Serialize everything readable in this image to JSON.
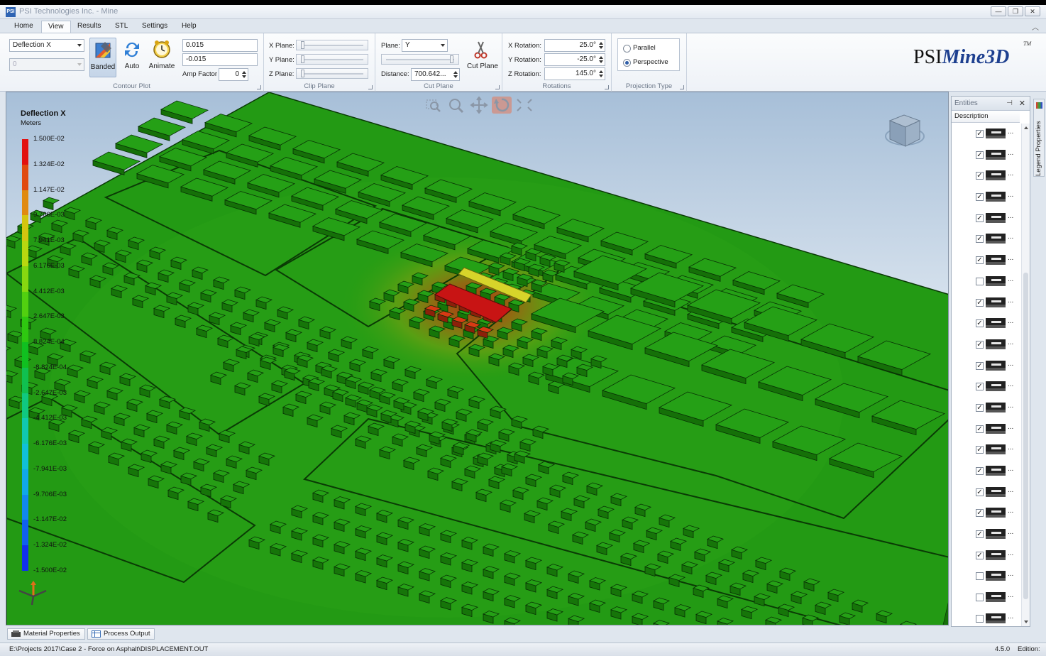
{
  "window": {
    "app_icon": "PSI",
    "title": "PSI Technologies Inc. - Mine",
    "controls": [
      "—",
      "❐",
      "✕"
    ]
  },
  "ribbon_tabs": [
    "Home",
    "View",
    "Results",
    "STL",
    "Settings",
    "Help"
  ],
  "active_tab": "View",
  "contour_plot": {
    "label": "Contour Plot",
    "result_select": "Deflection X",
    "component_select": "0",
    "banded_label": "Banded",
    "auto_label": "Auto",
    "animate_label": "Animate",
    "max_value": "0.015",
    "min_value": "-0.015",
    "amp_factor_label": "Amp Factor",
    "amp_factor": "0"
  },
  "clip_plane": {
    "label": "Clip Plane",
    "x_label": "X Plane:",
    "y_label": "Y Plane:",
    "z_label": "Z Plane:"
  },
  "cut_plane": {
    "label": "Cut Plane",
    "plane_label": "Plane:",
    "plane_value": "Y",
    "distance_label": "Distance:",
    "distance_value": "700.642...",
    "cut_button_label": "Cut Plane"
  },
  "rotations": {
    "label": "Rotations",
    "x_label": "X Rotation:",
    "x_value": "25.0°",
    "y_label": "Y Rotation:",
    "y_value": "-25.0°",
    "z_label": "Z Rotation:",
    "z_value": "145.0°"
  },
  "projection": {
    "label": "Projection Type",
    "parallel": "Parallel",
    "perspective": "Perspective",
    "selected": "Perspective"
  },
  "logo": {
    "psi": "PSI",
    "mine3d": "Mine3D",
    "tm": "TM"
  },
  "legend": {
    "title": "Deflection X",
    "units": "Meters",
    "ticks": [
      "1.500E-02",
      "1.324E-02",
      "1.147E-02",
      "9.706E-03",
      "7.941E-03",
      "6.176E-03",
      "4.412E-03",
      "2.647E-03",
      "8.824E-04",
      "-8.824E-04",
      "-2.647E-03",
      "-4.412E-03",
      "-6.176E-03",
      "-7.941E-03",
      "-9.706E-03",
      "-1.147E-02",
      "-1.324E-02",
      "-1.500E-02"
    ],
    "colors": [
      "#e21010",
      "#e04a10",
      "#e08a10",
      "#d4c510",
      "#b8d810",
      "#86d810",
      "#52d010",
      "#2ec810",
      "#10c020",
      "#10c050",
      "#10c880",
      "#10c8b0",
      "#10c0d8",
      "#10a8e8",
      "#1088f0",
      "#1060f0",
      "#1030f0",
      "#1010e8"
    ]
  },
  "entities": {
    "title": "Entities",
    "column": "Description",
    "rows": [
      true,
      true,
      true,
      true,
      true,
      true,
      true,
      false,
      true,
      true,
      true,
      true,
      true,
      true,
      true,
      true,
      true,
      true,
      true,
      true,
      true,
      false,
      false,
      false
    ],
    "row_dots": "..."
  },
  "side_tab": "Legend Properties",
  "bottom_tabs": [
    "Material Properties",
    "Process Output"
  ],
  "status": {
    "path": "E:\\Projects 2017\\Case 2 - Force on Asphalt\\DISPLACEMENT.OUT",
    "version": "4.5.0",
    "edition_label": "Edition:"
  }
}
